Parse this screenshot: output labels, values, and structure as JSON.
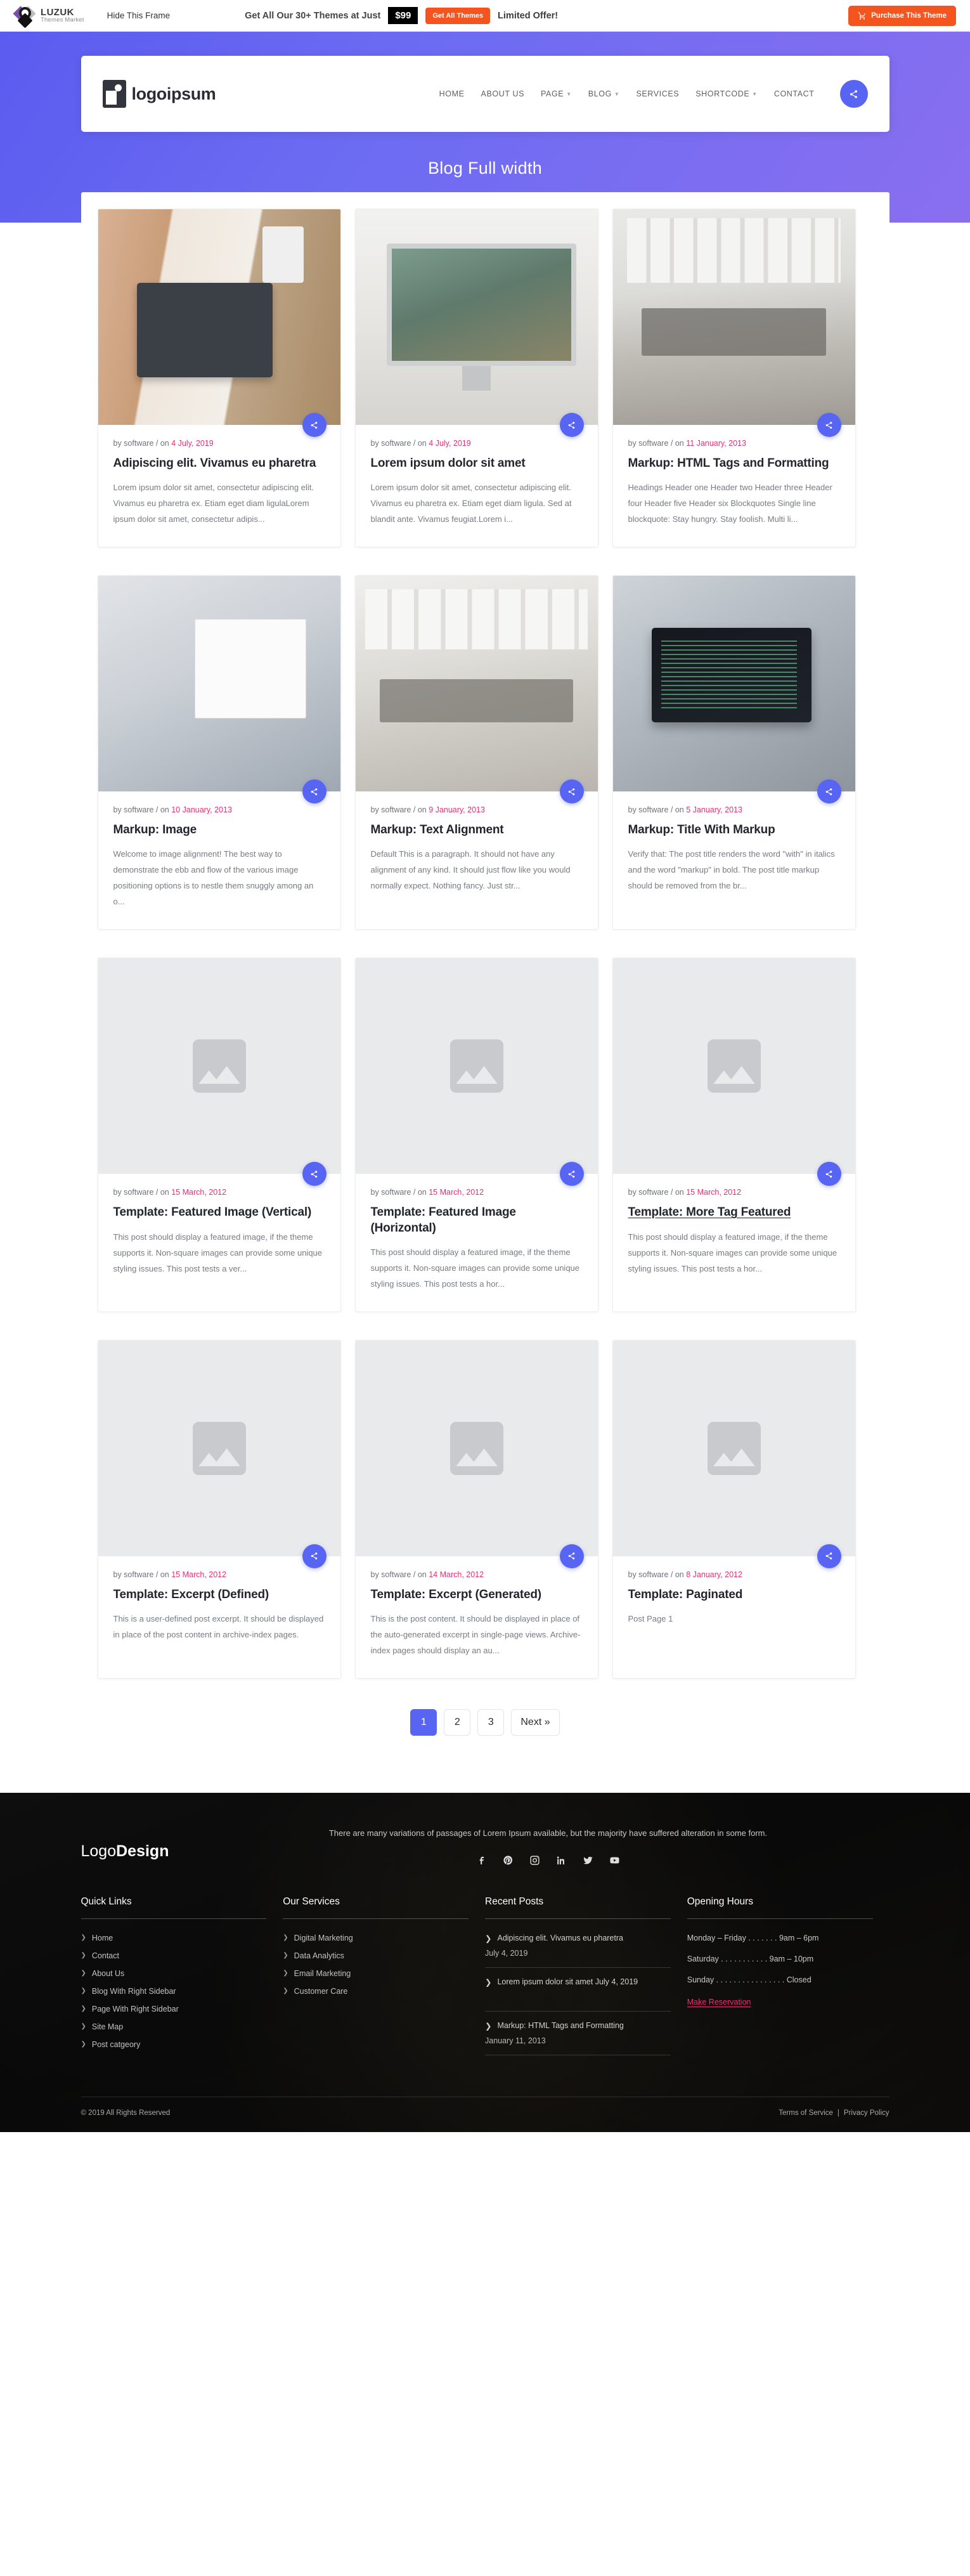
{
  "topbar": {
    "brand_name": "LUZUK",
    "brand_sub": "Themes Market",
    "hide_frame": "Hide This Frame",
    "promo_text": "Get All Our 30+ Themes at Just",
    "price": "$99",
    "get_all_btn": "Get All Themes",
    "limited": "Limited Offer!",
    "purchase_btn": "Purchase This Theme"
  },
  "header": {
    "logo_text": "logoipsum",
    "nav": [
      {
        "label": "HOME",
        "caret": false
      },
      {
        "label": "ABOUT US",
        "caret": false
      },
      {
        "label": "PAGE",
        "caret": true
      },
      {
        "label": "BLOG",
        "caret": true
      },
      {
        "label": "SERVICES",
        "caret": false
      },
      {
        "label": "SHORTCODE",
        "caret": true
      },
      {
        "label": "CONTACT",
        "caret": false
      }
    ]
  },
  "hero": {
    "title": "Blog Full width"
  },
  "posts": [
    {
      "author": "by software / on ",
      "date": "4 July, 2019",
      "title": "Adipiscing elit. Vivamus eu pharetra",
      "excerpt": "Lorem ipsum dolor sit amet, consectetur adipiscing elit. Vivamus eu pharetra ex. Etiam eget diam ligulaLorem ipsum dolor sit amet, consectetur adipis...",
      "thumb": "photo-laptop-hands",
      "underline": false
    },
    {
      "author": "by software / on ",
      "date": "4 July, 2019",
      "title": "Lorem ipsum dolor sit amet",
      "excerpt": "Lorem ipsum dolor sit amet, consectetur adipiscing elit. Vivamus eu pharetra ex. Etiam eget diam ligula. Sed at blandit ante. Vivamus feugiat.Lorem i...",
      "thumb": "photo-imac-desk",
      "underline": false
    },
    {
      "author": "by software / on ",
      "date": "11 January, 2013",
      "title": "Markup: HTML Tags and Formatting",
      "excerpt": "Headings Header one Header two Header three Header four Header five Header six Blockquotes Single line blockquote: Stay hungry. Stay foolish. Multi li...",
      "thumb": "photo-office-room",
      "underline": false
    },
    {
      "author": "by software / on ",
      "date": "10 January, 2013",
      "title": "Markup: Image",
      "excerpt": "Welcome to image alignment! The best way to demonstrate the ebb and flow of the various image positioning options is to nestle them snuggly among an o...",
      "thumb": "photo-analytics-chart",
      "underline": false
    },
    {
      "author": "by software / on ",
      "date": "9 January, 2013",
      "title": "Markup: Text Alignment",
      "excerpt": "Default This is a paragraph. It should not have any alignment of any kind. It should just flow like you would normally expect. Nothing fancy. Just str...",
      "thumb": "photo-meeting-room",
      "underline": false
    },
    {
      "author": "by software / on ",
      "date": "5 January, 2013",
      "title": "Markup: Title With Markup",
      "excerpt": "Verify that: The post title renders the word \"with\" in italics and the word \"markup\" in bold. The post title markup should be removed from the br...",
      "thumb": "photo-code-laptop",
      "underline": false
    },
    {
      "author": "by software / on ",
      "date": "15 March, 2012",
      "title": "Template: Featured Image (Vertical)",
      "excerpt": "This post should display a featured image, if the theme supports it. Non-square images can provide some unique styling issues. This post tests a ver...",
      "thumb": "placeholder",
      "underline": false
    },
    {
      "author": "by software / on ",
      "date": "15 March, 2012",
      "title": "Template: Featured Image (Horizontal)",
      "excerpt": "This post should display a featured image, if the theme supports it. Non-square images can provide some unique styling issues. This post tests a hor...",
      "thumb": "placeholder",
      "underline": false
    },
    {
      "author": "by software / on ",
      "date": "15 March, 2012",
      "title": "Template: More Tag Featured",
      "excerpt": "This post should display a featured image, if the theme supports it. Non-square images can provide some unique styling issues. This post tests a hor...",
      "thumb": "placeholder",
      "underline": true
    },
    {
      "author": "by software / on ",
      "date": "15 March, 2012",
      "title": "Template: Excerpt (Defined)",
      "excerpt": "This is a user-defined post excerpt. It should be displayed in place of the post content in archive-index pages.",
      "thumb": "placeholder",
      "underline": false
    },
    {
      "author": "by software / on ",
      "date": "14 March, 2012",
      "title": "Template: Excerpt (Generated)",
      "excerpt": "This is the post content. It should be displayed in place of the auto-generated excerpt in single-page views. Archive-index pages should display an au...",
      "thumb": "placeholder",
      "underline": false
    },
    {
      "author": "by software / on ",
      "date": "8 January, 2012",
      "title": "Template: Paginated",
      "excerpt": "Post Page 1",
      "thumb": "placeholder",
      "underline": false
    }
  ],
  "pagination": [
    {
      "label": "1",
      "active": true
    },
    {
      "label": "2",
      "active": false
    },
    {
      "label": "3",
      "active": false
    },
    {
      "label": "Next »",
      "active": false
    }
  ],
  "footer": {
    "logo_light": "Logo",
    "logo_bold": "Design",
    "tagline": "There are many variations of passages of Lorem Ipsum available, but the majority have suffered alteration in some form.",
    "socials": [
      "facebook-icon",
      "pinterest-icon",
      "instagram-icon",
      "linkedin-icon",
      "twitter-icon",
      "youtube-icon"
    ],
    "quick_links": {
      "title": "Quick Links",
      "items": [
        "Home",
        "Contact",
        "About Us",
        "Blog With Right Sidebar",
        "Page With Right Sidebar",
        "Site Map",
        "Post catgeory"
      ]
    },
    "services": {
      "title": "Our Services",
      "items": [
        "Digital Marketing",
        "Data Analytics",
        "Email Marketing",
        "Customer Care"
      ]
    },
    "recent": {
      "title": "Recent Posts",
      "items": [
        {
          "title": "Adipiscing elit. Vivamus eu pharetra",
          "date": "July 4, 2019"
        },
        {
          "title": "Lorem ipsum dolor sit amet July 4, 2019",
          "date": ""
        },
        {
          "title": "Markup: HTML Tags and Formatting",
          "date": "January 11, 2013"
        }
      ]
    },
    "hours": {
      "title": "Opening Hours",
      "rows": [
        "Monday – Friday . . . . . . . 9am – 6pm",
        "Saturday . . . . . . . . . . . 9am – 10pm",
        "Sunday . . . . . . . . . . . . . . . . Closed"
      ],
      "reservation": "Make Reservation"
    },
    "copyright": "© 2019 All Rights Reserved",
    "terms": "Terms of Service",
    "divider": "|",
    "privacy": "Privacy Policy"
  },
  "colors": {
    "accent": "#5865f2",
    "pink": "#ec2d72",
    "orange": "#f4551f"
  }
}
